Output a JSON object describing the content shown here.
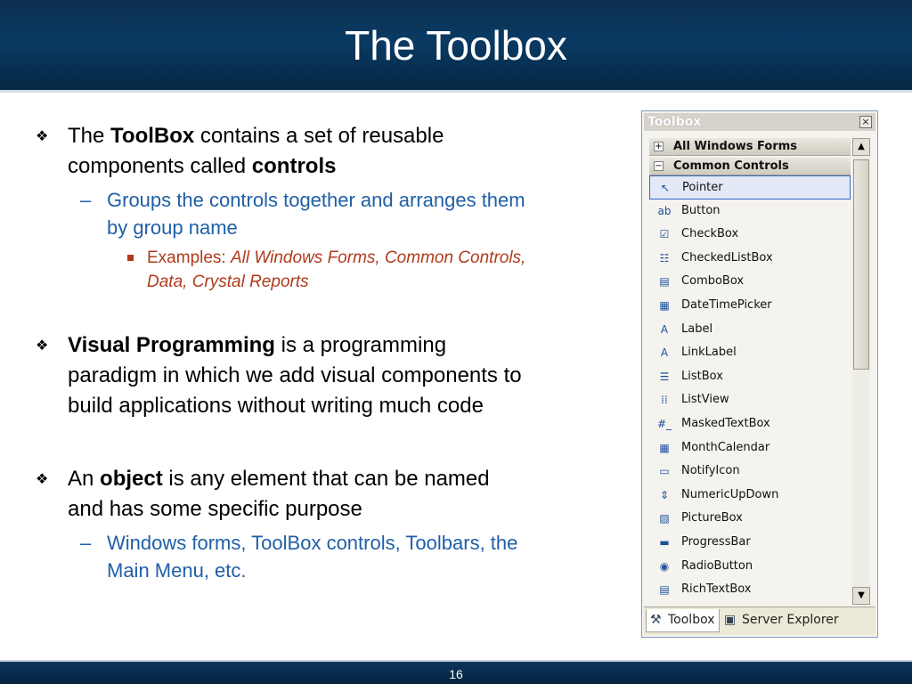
{
  "slide": {
    "title": "The Toolbox",
    "page_number": "16"
  },
  "bullets": {
    "b1": {
      "pre": "The ",
      "bold1": "ToolBox",
      "mid": " contains a set of reusable",
      "line2pre": "components called ",
      "bold2": "controls"
    },
    "b1_sub": {
      "line1": "Groups the controls together and arranges them",
      "line2": "by group name"
    },
    "b1_subsub": {
      "label": "Examples: ",
      "italic_line1": "All Windows Forms, Common Controls,",
      "italic_line2": "Data, Crystal Reports"
    },
    "b2": {
      "bold": "Visual Programming",
      "line1rest": " is a programming",
      "line2": "paradigm in which we add visual components to",
      "line3": "build applications without writing much code"
    },
    "b3": {
      "pre": "An ",
      "bold": "object",
      "line1rest": " is any element that can be named",
      "line2": "and has some specific purpose"
    },
    "b3_sub": {
      "line1": "Windows forms, ToolBox controls, Toolbars, the",
      "line2": "Main Menu, etc."
    }
  },
  "toolbox": {
    "title": "Toolbox",
    "close_symbol": "×",
    "groups": [
      {
        "sign": "+",
        "label": "All Windows Forms"
      },
      {
        "sign": "−",
        "label": "Common Controls"
      }
    ],
    "items": [
      {
        "label": "Pointer",
        "icon": "pointer-icon",
        "glyph": "↖"
      },
      {
        "label": "Button",
        "icon": "button-icon",
        "glyph": "ab"
      },
      {
        "label": "CheckBox",
        "icon": "checkbox-icon",
        "glyph": "☑"
      },
      {
        "label": "CheckedListBox",
        "icon": "checkedlistbox-icon",
        "glyph": "☷"
      },
      {
        "label": "ComboBox",
        "icon": "combobox-icon",
        "glyph": "▤"
      },
      {
        "label": "DateTimePicker",
        "icon": "datetimepicker-icon",
        "glyph": "▦"
      },
      {
        "label": "Label",
        "icon": "label-icon",
        "glyph": "A"
      },
      {
        "label": "LinkLabel",
        "icon": "linklabel-icon",
        "glyph": "A"
      },
      {
        "label": "ListBox",
        "icon": "listbox-icon",
        "glyph": "☰"
      },
      {
        "label": "ListView",
        "icon": "listview-icon",
        "glyph": "⁞⁞"
      },
      {
        "label": "MaskedTextBox",
        "icon": "maskedtextbox-icon",
        "glyph": "#_"
      },
      {
        "label": "MonthCalendar",
        "icon": "monthcalendar-icon",
        "glyph": "▦"
      },
      {
        "label": "NotifyIcon",
        "icon": "notifyicon-icon",
        "glyph": "▭"
      },
      {
        "label": "NumericUpDown",
        "icon": "numericupdown-icon",
        "glyph": "⇕"
      },
      {
        "label": "PictureBox",
        "icon": "picturebox-icon",
        "glyph": "▨"
      },
      {
        "label": "ProgressBar",
        "icon": "progressbar-icon",
        "glyph": "▬"
      },
      {
        "label": "RadioButton",
        "icon": "radiobutton-icon",
        "glyph": "◉"
      },
      {
        "label": "RichTextBox",
        "icon": "richtextbox-icon",
        "glyph": "▤"
      }
    ],
    "scroll_up": "▲",
    "scroll_down": "▼",
    "tabs": [
      {
        "label": "Toolbox",
        "glyph": "⚒"
      },
      {
        "label": "Server Explorer",
        "glyph": "▣"
      }
    ]
  }
}
